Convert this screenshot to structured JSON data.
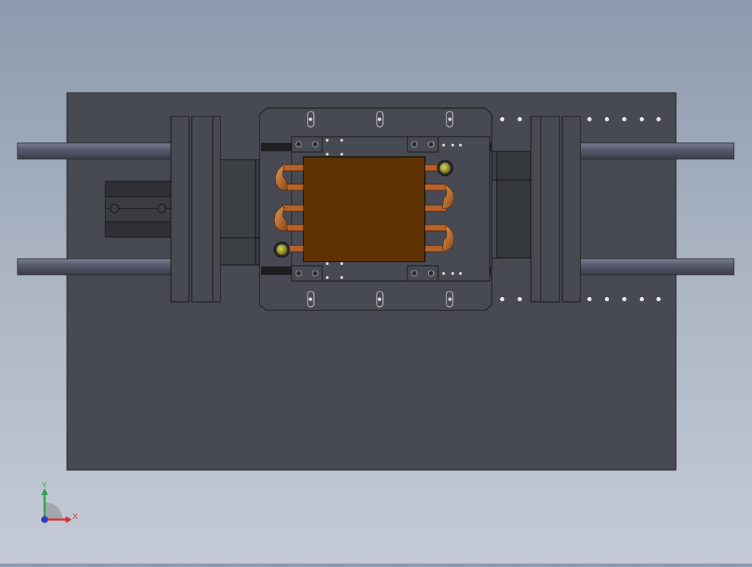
{
  "viewport": {
    "background_top": "#8d9aad",
    "background_bottom": "#c4cbd6"
  },
  "model": {
    "base_plate_color": "#474a52",
    "edge_color": "#1a1b1e",
    "rod_color": "#5a5d6e",
    "copper_color": "#5e3100",
    "clip_color": "#c06a2a",
    "screw_head_color": "#9c9a1e"
  },
  "triad": {
    "x_label": "X",
    "y_label": "Y",
    "x_color": "#d43030",
    "y_color": "#2fa44a",
    "z_color": "#2a3fbf"
  }
}
